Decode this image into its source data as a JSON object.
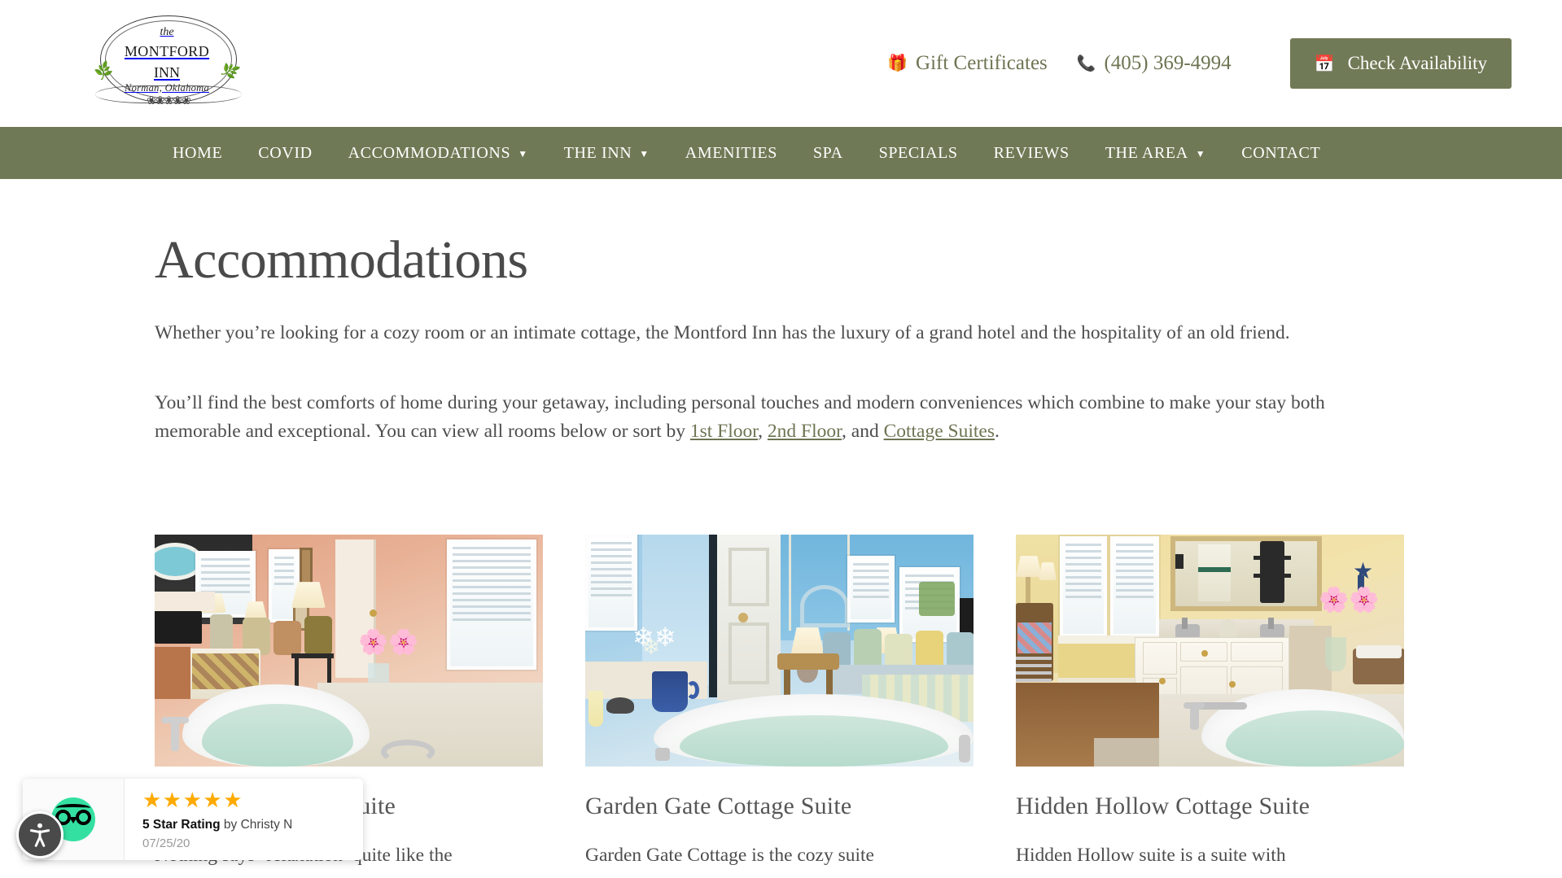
{
  "header": {
    "logo": {
      "the": "the",
      "name": "Montford",
      "name2": "Inn",
      "location": "Norman, Oklahoma"
    },
    "gift_icon": "gift-icon",
    "gift_label": "Gift Certificates",
    "phone_icon": "phone-icon",
    "phone_label": "(405) 369-4994",
    "cta_icon": "calendar-icon",
    "cta_label": "Check Availability",
    "accent_color": "#6d7553",
    "cta_bg": "#717a56"
  },
  "nav": {
    "background": "#707955",
    "items": [
      {
        "label": "HOME",
        "has_dropdown": false
      },
      {
        "label": "COVID",
        "has_dropdown": false
      },
      {
        "label": "ACCOMMODATIONS",
        "has_dropdown": true
      },
      {
        "label": "THE INN",
        "has_dropdown": true
      },
      {
        "label": "AMENITIES",
        "has_dropdown": false
      },
      {
        "label": "SPA",
        "has_dropdown": false
      },
      {
        "label": "SPECIALS",
        "has_dropdown": false
      },
      {
        "label": "REVIEWS",
        "has_dropdown": false
      },
      {
        "label": "THE AREA",
        "has_dropdown": true
      },
      {
        "label": "CONTACT",
        "has_dropdown": false
      }
    ]
  },
  "main": {
    "title": "Accommodations",
    "paragraph1": "Whether you’re looking for a cozy room or an intimate cottage, the Montford Inn has the luxury of a grand hotel and the hospitality of an old friend.",
    "paragraph2_part1": "You’ll find the best comforts of home during your getaway, including personal touches and modern conveniences which combine to make your stay both memorable and exceptional. You can view all rooms below or sort by ",
    "link_1st": "1st Floor",
    "sep_1": ", ",
    "link_2nd": "2nd Floor",
    "sep_2": ", and ",
    "link_cottage": "Cottage Suites",
    "sep_3": ".",
    "cards": [
      {
        "title": "Hideaway Cottage Suite",
        "desc": "Nothing says ‘relaxation’ quite like the",
        "image_alt": "peach bedroom with fireplace, four-poster bed and jacuzzi tub"
      },
      {
        "title": "Garden Gate Cottage Suite",
        "desc": "Garden Gate Cottage is the cozy suite",
        "image_alt": "blue bedroom with white daisies, lamp and jacuzzi tub"
      },
      {
        "title": "Hidden Hollow Cottage Suite",
        "desc": "Hidden Hollow suite is a suite with",
        "image_alt": "yellow bathroom with white vanity, gold mirror and jacuzzi tub"
      }
    ]
  },
  "tripadvisor": {
    "logo_icon": "tripadvisor-owl-icon",
    "stars": "★★★★★",
    "star_count": 5,
    "rating_bold": "5 Star Rating",
    "rating_by": " by Christy N",
    "date": "07/25/20",
    "star_color": "#ffaa00",
    "brand_color": "#34e0a1"
  },
  "accessibility": {
    "icon": "accessibility-icon",
    "label": "Accessibility options"
  }
}
